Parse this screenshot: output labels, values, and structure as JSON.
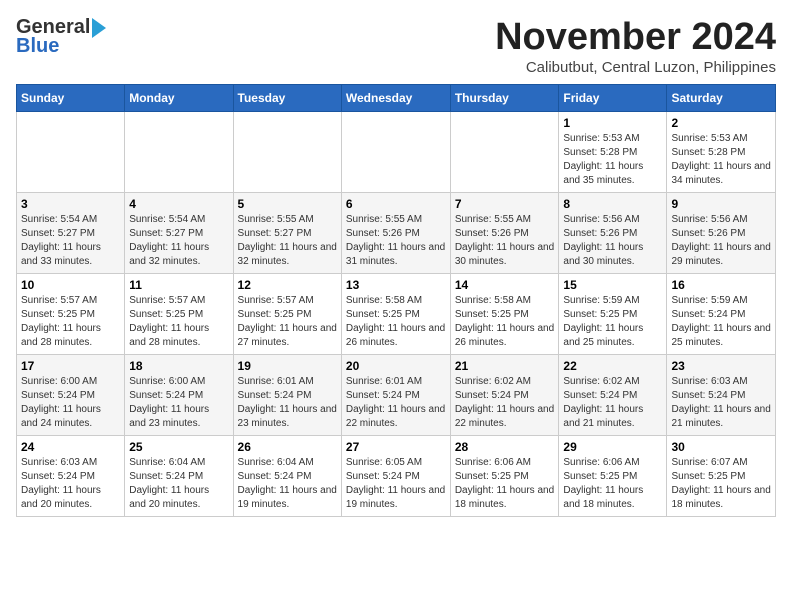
{
  "header": {
    "logo_line1": "General",
    "logo_line2": "Blue",
    "month_title": "November 2024",
    "location": "Calibutbut, Central Luzon, Philippines"
  },
  "columns": [
    "Sunday",
    "Monday",
    "Tuesday",
    "Wednesday",
    "Thursday",
    "Friday",
    "Saturday"
  ],
  "rows": [
    [
      {
        "num": "",
        "detail": ""
      },
      {
        "num": "",
        "detail": ""
      },
      {
        "num": "",
        "detail": ""
      },
      {
        "num": "",
        "detail": ""
      },
      {
        "num": "",
        "detail": ""
      },
      {
        "num": "1",
        "detail": "Sunrise: 5:53 AM\nSunset: 5:28 PM\nDaylight: 11 hours and 35 minutes."
      },
      {
        "num": "2",
        "detail": "Sunrise: 5:53 AM\nSunset: 5:28 PM\nDaylight: 11 hours and 34 minutes."
      }
    ],
    [
      {
        "num": "3",
        "detail": "Sunrise: 5:54 AM\nSunset: 5:27 PM\nDaylight: 11 hours and 33 minutes."
      },
      {
        "num": "4",
        "detail": "Sunrise: 5:54 AM\nSunset: 5:27 PM\nDaylight: 11 hours and 32 minutes."
      },
      {
        "num": "5",
        "detail": "Sunrise: 5:55 AM\nSunset: 5:27 PM\nDaylight: 11 hours and 32 minutes."
      },
      {
        "num": "6",
        "detail": "Sunrise: 5:55 AM\nSunset: 5:26 PM\nDaylight: 11 hours and 31 minutes."
      },
      {
        "num": "7",
        "detail": "Sunrise: 5:55 AM\nSunset: 5:26 PM\nDaylight: 11 hours and 30 minutes."
      },
      {
        "num": "8",
        "detail": "Sunrise: 5:56 AM\nSunset: 5:26 PM\nDaylight: 11 hours and 30 minutes."
      },
      {
        "num": "9",
        "detail": "Sunrise: 5:56 AM\nSunset: 5:26 PM\nDaylight: 11 hours and 29 minutes."
      }
    ],
    [
      {
        "num": "10",
        "detail": "Sunrise: 5:57 AM\nSunset: 5:25 PM\nDaylight: 11 hours and 28 minutes."
      },
      {
        "num": "11",
        "detail": "Sunrise: 5:57 AM\nSunset: 5:25 PM\nDaylight: 11 hours and 28 minutes."
      },
      {
        "num": "12",
        "detail": "Sunrise: 5:57 AM\nSunset: 5:25 PM\nDaylight: 11 hours and 27 minutes."
      },
      {
        "num": "13",
        "detail": "Sunrise: 5:58 AM\nSunset: 5:25 PM\nDaylight: 11 hours and 26 minutes."
      },
      {
        "num": "14",
        "detail": "Sunrise: 5:58 AM\nSunset: 5:25 PM\nDaylight: 11 hours and 26 minutes."
      },
      {
        "num": "15",
        "detail": "Sunrise: 5:59 AM\nSunset: 5:25 PM\nDaylight: 11 hours and 25 minutes."
      },
      {
        "num": "16",
        "detail": "Sunrise: 5:59 AM\nSunset: 5:24 PM\nDaylight: 11 hours and 25 minutes."
      }
    ],
    [
      {
        "num": "17",
        "detail": "Sunrise: 6:00 AM\nSunset: 5:24 PM\nDaylight: 11 hours and 24 minutes."
      },
      {
        "num": "18",
        "detail": "Sunrise: 6:00 AM\nSunset: 5:24 PM\nDaylight: 11 hours and 23 minutes."
      },
      {
        "num": "19",
        "detail": "Sunrise: 6:01 AM\nSunset: 5:24 PM\nDaylight: 11 hours and 23 minutes."
      },
      {
        "num": "20",
        "detail": "Sunrise: 6:01 AM\nSunset: 5:24 PM\nDaylight: 11 hours and 22 minutes."
      },
      {
        "num": "21",
        "detail": "Sunrise: 6:02 AM\nSunset: 5:24 PM\nDaylight: 11 hours and 22 minutes."
      },
      {
        "num": "22",
        "detail": "Sunrise: 6:02 AM\nSunset: 5:24 PM\nDaylight: 11 hours and 21 minutes."
      },
      {
        "num": "23",
        "detail": "Sunrise: 6:03 AM\nSunset: 5:24 PM\nDaylight: 11 hours and 21 minutes."
      }
    ],
    [
      {
        "num": "24",
        "detail": "Sunrise: 6:03 AM\nSunset: 5:24 PM\nDaylight: 11 hours and 20 minutes."
      },
      {
        "num": "25",
        "detail": "Sunrise: 6:04 AM\nSunset: 5:24 PM\nDaylight: 11 hours and 20 minutes."
      },
      {
        "num": "26",
        "detail": "Sunrise: 6:04 AM\nSunset: 5:24 PM\nDaylight: 11 hours and 19 minutes."
      },
      {
        "num": "27",
        "detail": "Sunrise: 6:05 AM\nSunset: 5:24 PM\nDaylight: 11 hours and 19 minutes."
      },
      {
        "num": "28",
        "detail": "Sunrise: 6:06 AM\nSunset: 5:25 PM\nDaylight: 11 hours and 18 minutes."
      },
      {
        "num": "29",
        "detail": "Sunrise: 6:06 AM\nSunset: 5:25 PM\nDaylight: 11 hours and 18 minutes."
      },
      {
        "num": "30",
        "detail": "Sunrise: 6:07 AM\nSunset: 5:25 PM\nDaylight: 11 hours and 18 minutes."
      }
    ]
  ]
}
